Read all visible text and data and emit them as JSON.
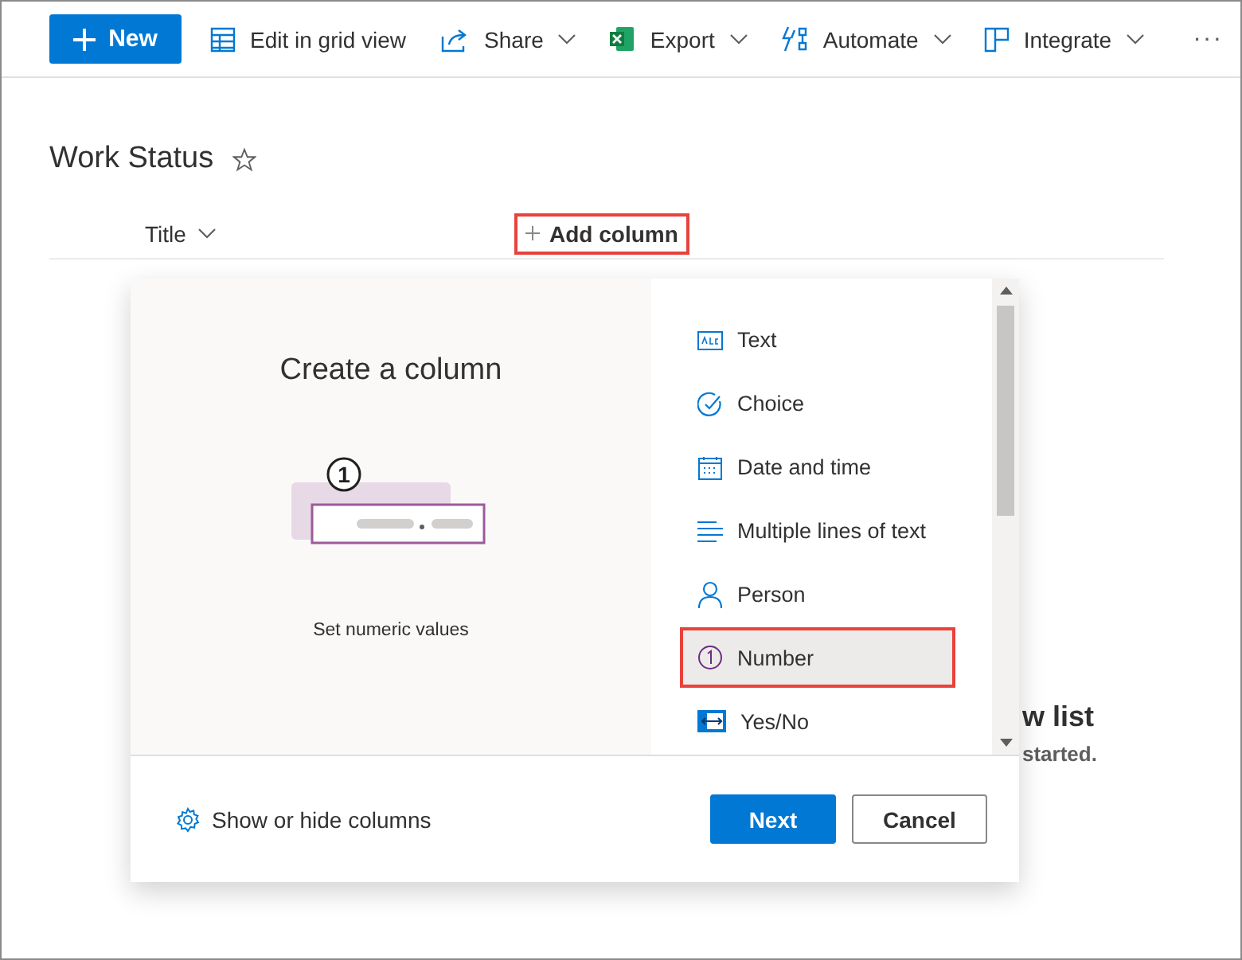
{
  "toolbar": {
    "new_button": {
      "label": "New"
    },
    "items": [
      {
        "label": "Edit in grid view",
        "dropdown": false
      },
      {
        "label": "Share",
        "dropdown": true
      },
      {
        "label": "Export",
        "dropdown": true
      },
      {
        "label": "Automate",
        "dropdown": true
      },
      {
        "label": "Integrate",
        "dropdown": true
      }
    ],
    "more": "···"
  },
  "list_title": "Work Status",
  "favorite": false,
  "columns": [
    {
      "label": "Title",
      "kind": "header"
    },
    {
      "label": "Add column",
      "kind": "add",
      "highlighted": true
    }
  ],
  "empty_state": {
    "title": "w list",
    "subtitle": "started."
  },
  "panel": {
    "title": "Create a column",
    "description": "Set numeric values",
    "illustration_number": "1",
    "column_types": [
      {
        "label": "Text",
        "selected": false
      },
      {
        "label": "Choice",
        "selected": false
      },
      {
        "label": "Date and time",
        "selected": false
      },
      {
        "label": "Multiple lines of text",
        "selected": false
      },
      {
        "label": "Person",
        "selected": false
      },
      {
        "label": "Number",
        "selected": true
      },
      {
        "label": "Yes/No",
        "selected": false
      }
    ],
    "footer_link": "Show or hide columns",
    "buttons": [
      {
        "label": "Next",
        "kind": "primary"
      },
      {
        "label": "Cancel",
        "kind": "secondary"
      }
    ]
  }
}
